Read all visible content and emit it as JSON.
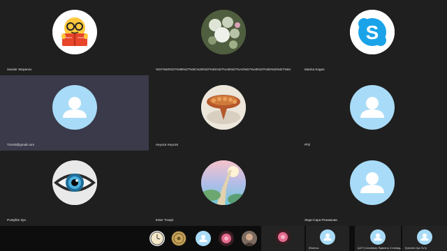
{
  "participants": [
    {
      "name": "Sander Stepanov",
      "avatar": "nerd-reading-emoji"
    },
    {
      "name": "%D7%92%D7%99%D7%9C%20%D7%91%D7%A8%D7%A0%D7%A8%D7%93%20%D7%94",
      "avatar": "flowers-photo"
    },
    {
      "name": "Marina Kogan",
      "avatar": "skype-logo"
    },
    {
      "name": "Tzvi40@gmail.com",
      "avatar": "default-person"
    },
    {
      "name": "rreyv15 rreyv15",
      "avatar": "challah-photo"
    },
    {
      "name": "Phil",
      "avatar": "default-person"
    },
    {
      "name": "Pustylkin Ilya",
      "avatar": "eye-photo"
    },
    {
      "name": "Ester Trasyk",
      "avatar": "stairway-photo"
    },
    {
      "name": "Леди-Сара Резникова",
      "avatar": "default-person"
    }
  ],
  "strip": {
    "thumbnails": [
      "clock-icon",
      "coin-icon",
      "default-person",
      "pink-flower-photo",
      "portrait-photo"
    ],
    "tiles": [
      {
        "avatar": "pink-flower-photo",
        "name": ""
      },
      {
        "avatar": "default-person",
        "name": "Elisheva"
      },
      {
        "avatar": "default-person",
        "name": "(ШГ?) Шлойфер Ядвемту Стлевед..."
      },
      {
        "avatar": "default-person",
        "name": "Epshtein Ilya Ta?p"
      }
    ]
  },
  "colors": {
    "tile_bg": "#1f1f1f",
    "tile_bg_alt": "#252525",
    "tile_highlight": "#3a3a4a",
    "avatar_default": "#a8dbf7",
    "strip_bg": "#0d0d0d"
  }
}
